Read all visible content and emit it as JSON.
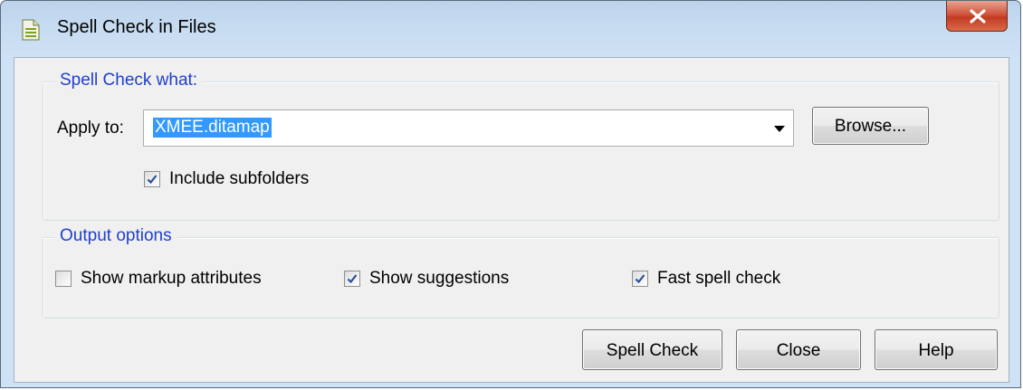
{
  "window": {
    "title": "Spell Check in Files"
  },
  "spell_check_what": {
    "legend": "Spell Check what:",
    "apply_to_label": "Apply to:",
    "apply_to_value": "XMEE.ditamap",
    "browse_label": "Browse...",
    "include_subfolders": {
      "label": "Include subfolders",
      "checked": true
    }
  },
  "output_options": {
    "legend": "Output options",
    "show_markup_attributes": {
      "label": "Show markup attributes",
      "checked": false
    },
    "show_suggestions": {
      "label": "Show suggestions",
      "checked": true
    },
    "fast_spell_check": {
      "label": "Fast spell check",
      "checked": true
    }
  },
  "buttons": {
    "spell_check": "Spell Check",
    "close": "Close",
    "help": "Help"
  },
  "colors": {
    "legend_text": "#1f3fcf",
    "selection": "#3399ff",
    "close_button": "#c23b23"
  },
  "icons": {
    "app": "document-icon",
    "close": "close-icon",
    "dropdown": "dropdown-arrow-icon",
    "check": "check-icon"
  }
}
